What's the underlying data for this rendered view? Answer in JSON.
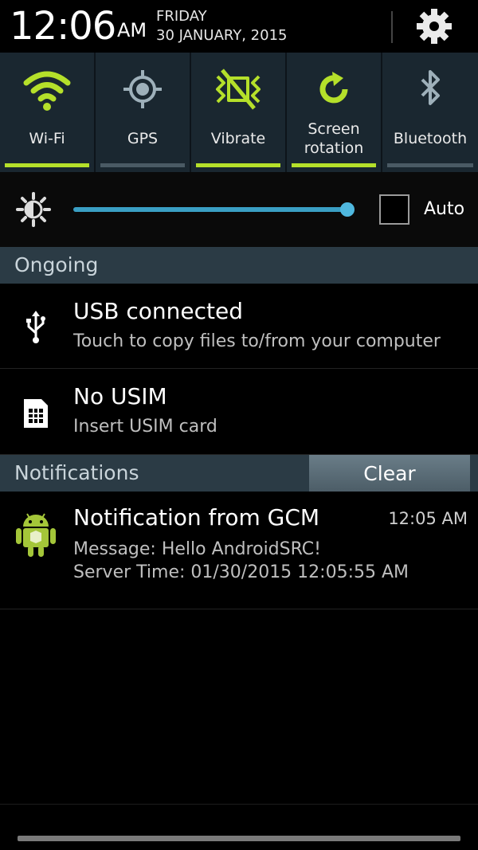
{
  "header": {
    "time": "12:06",
    "ampm": "AM",
    "day": "FRIDAY",
    "date": "30 JANUARY, 2015",
    "settings_icon": "gear-icon"
  },
  "toggles": [
    {
      "label": "Wi-Fi",
      "icon": "wifi-icon",
      "on": true
    },
    {
      "label": "GPS",
      "icon": "gps-icon",
      "on": false
    },
    {
      "label": "Vibrate",
      "icon": "vibrate-icon",
      "on": true
    },
    {
      "label": "Screen rotation",
      "icon": "rotation-icon",
      "on": true
    },
    {
      "label": "Bluetooth",
      "icon": "bluetooth-icon",
      "on": false
    }
  ],
  "brightness": {
    "level": 1.0,
    "auto_label": "Auto",
    "auto_checked": false
  },
  "ongoing": {
    "title": "Ongoing",
    "items": [
      {
        "title": "USB connected",
        "subtitle": "Touch to copy files to/from your computer",
        "icon": "usb-icon"
      },
      {
        "title": "No USIM",
        "subtitle": "Insert USIM card",
        "icon": "sim-card-icon"
      }
    ]
  },
  "notifications": {
    "title": "Notifications",
    "clear_label": "Clear",
    "items": [
      {
        "title": "Notification from GCM",
        "time": "12:05 AM",
        "line1": "Message: Hello AndroidSRC!",
        "line2": "Server Time: 01/30/2015 12:05:55 AM",
        "icon": "android-icon"
      }
    ]
  },
  "colors": {
    "accent_on": "#b5e02a",
    "slider": "#3a9fc4",
    "panel_bg": "#1a2730",
    "section_bg": "#2b3b45"
  }
}
